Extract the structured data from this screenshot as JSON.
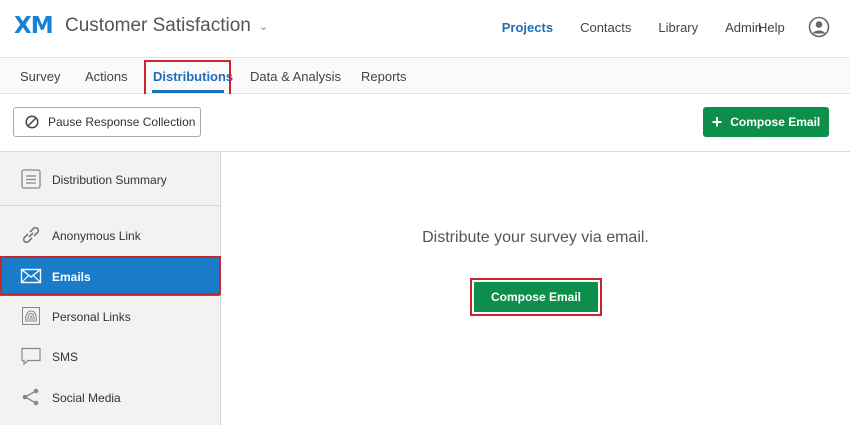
{
  "header": {
    "logo": "XM",
    "project_title": "Customer Satisfaction",
    "nav": [
      "Projects",
      "Contacts",
      "Library",
      "Admin"
    ],
    "help": "Help",
    "active_nav": "Projects"
  },
  "tabs": [
    {
      "label": "Survey"
    },
    {
      "label": "Actions"
    },
    {
      "label": "Distributions"
    },
    {
      "label": "Data & Analysis"
    },
    {
      "label": "Reports"
    }
  ],
  "toolbar": {
    "pause_label": "Pause Response Collection",
    "compose_label": "Compose Email"
  },
  "sidebar": {
    "summary": "Distribution Summary",
    "items": [
      {
        "label": "Anonymous Link",
        "icon": "link-icon"
      },
      {
        "label": "Emails",
        "icon": "envelope-icon"
      },
      {
        "label": "Personal Links",
        "icon": "fingerprint-icon"
      },
      {
        "label": "SMS",
        "icon": "speech-bubble-icon"
      },
      {
        "label": "Social Media",
        "icon": "share-icon"
      }
    ],
    "active": "Emails"
  },
  "main": {
    "message": "Distribute your survey via email.",
    "compose_label": "Compose Email"
  },
  "colors": {
    "accent": "#1f6fb8",
    "brand_logo": "#1582d8",
    "primary_button": "#0d8f4b",
    "highlight": "#c8272e",
    "sidebar_active": "#1a7bc9"
  }
}
